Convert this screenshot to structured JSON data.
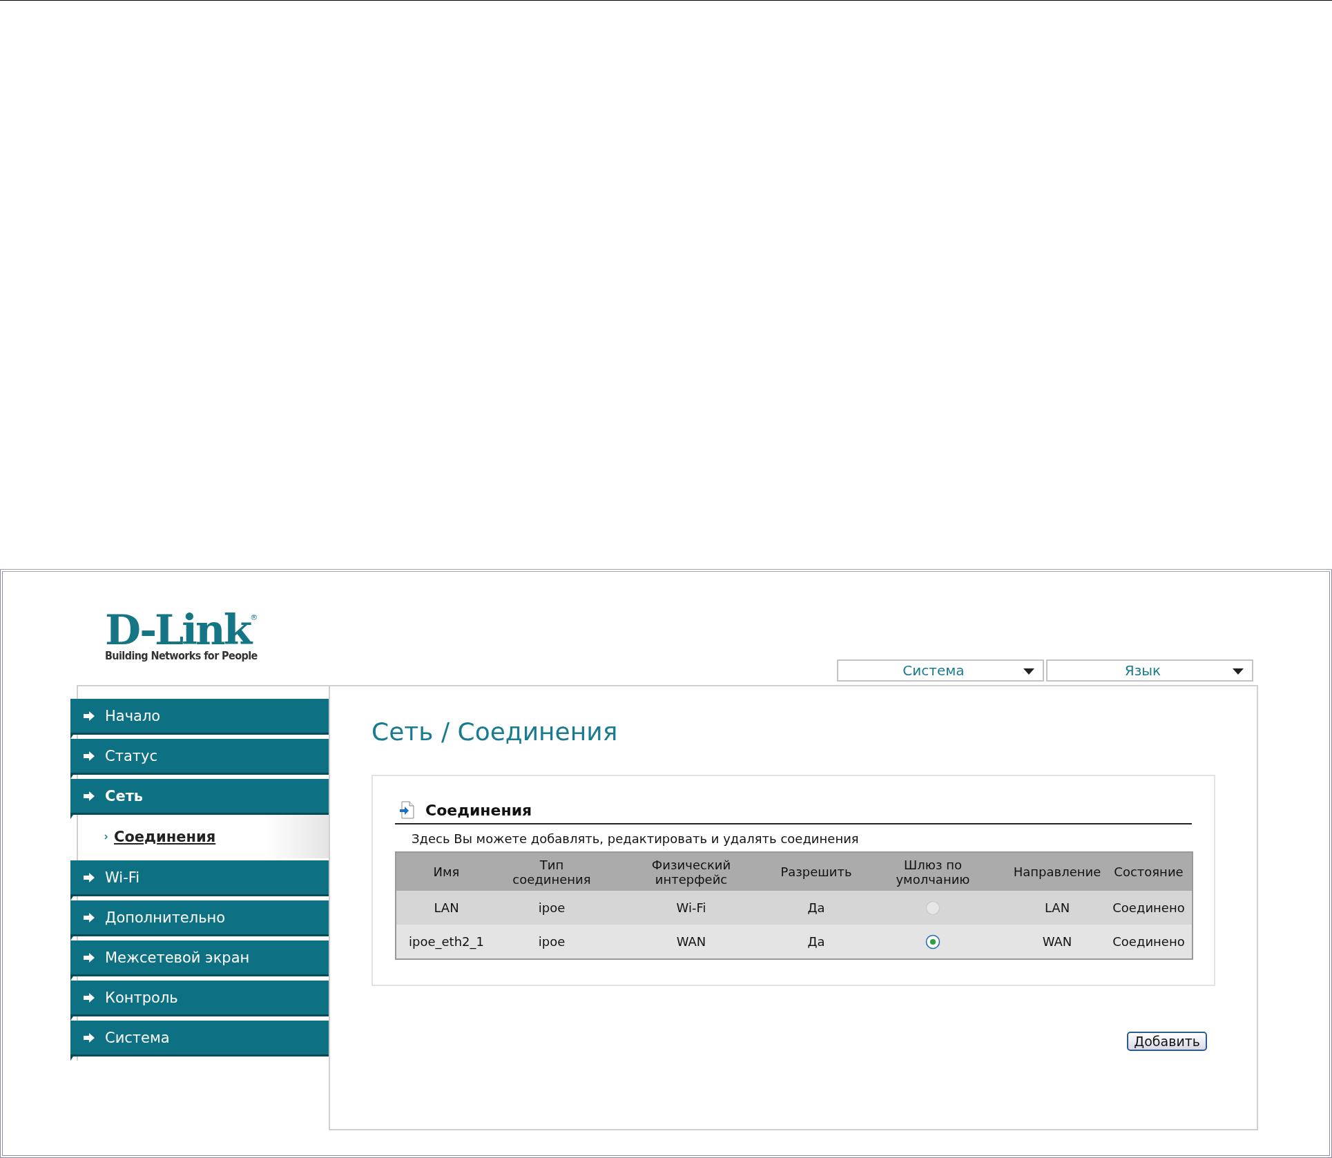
{
  "header": {
    "logo": {
      "brand": "D-Link",
      "mark": "®",
      "tagline": "Building Networks for People"
    },
    "menus": [
      {
        "label": "Система"
      },
      {
        "label": "Язык"
      }
    ]
  },
  "sidebar": {
    "items": [
      {
        "label": "Начало",
        "selected": false
      },
      {
        "label": "Статус",
        "selected": false
      },
      {
        "label": "Сеть",
        "selected": true,
        "children": [
          {
            "label": "Соединения",
            "selected": true
          }
        ]
      },
      {
        "label": "Wi-Fi",
        "selected": false
      },
      {
        "label": "Дополнительно",
        "selected": false
      },
      {
        "label": "Межсетевой экран",
        "selected": false
      },
      {
        "label": "Контроль",
        "selected": false
      },
      {
        "label": "Система",
        "selected": false
      }
    ]
  },
  "page_title": "Сеть / Соединения",
  "section": {
    "title": "Соединения",
    "description": "Здесь Вы можете добавлять, редактировать и удалять соединения",
    "table": {
      "columns": [
        "Имя",
        "Тип\nсоединения",
        "Физический\nинтерфейс",
        "Разрешить",
        "Шлюз по\nумолчанию",
        "Направление",
        "Состояние"
      ],
      "rows": [
        {
          "name": "LAN",
          "type": "ipoe",
          "interface": "Wi-Fi",
          "enabled": "Да",
          "default_gateway": false,
          "direction": "LAN",
          "status": "Соединено"
        },
        {
          "name": "ipoe_eth2_1",
          "type": "ipoe",
          "interface": "WAN",
          "enabled": "Да",
          "default_gateway": true,
          "direction": "WAN",
          "status": "Соединено"
        }
      ]
    }
  },
  "buttons": [
    "Добавить"
  ]
}
